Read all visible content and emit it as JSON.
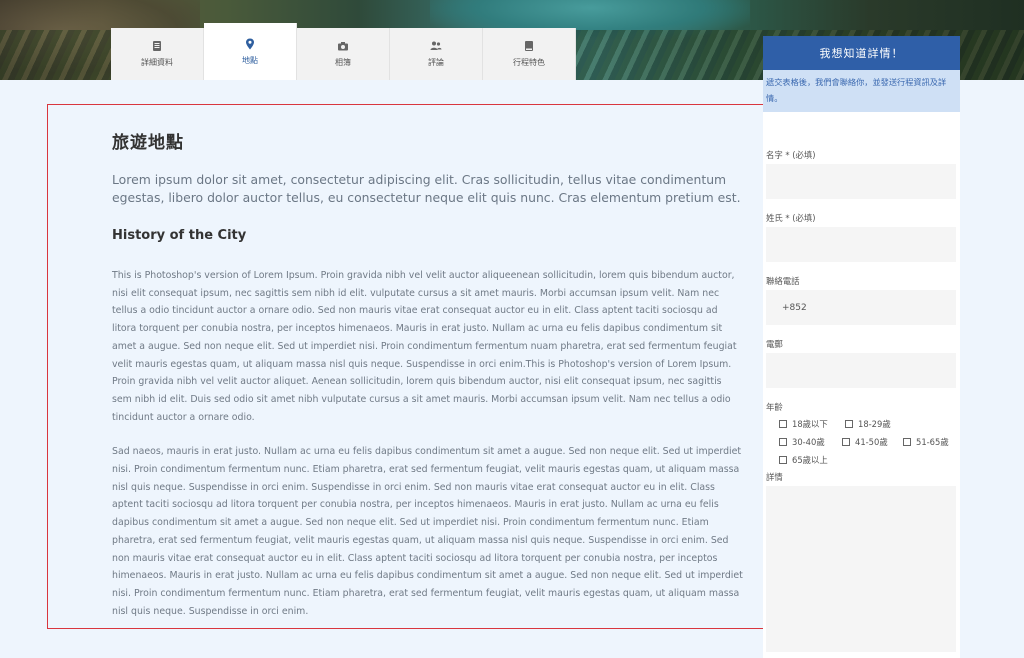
{
  "tabs": [
    {
      "label": "詳細資料",
      "icon": "document-icon"
    },
    {
      "label": "地點",
      "icon": "location-pin-icon"
    },
    {
      "label": "相簿",
      "icon": "camera-icon"
    },
    {
      "label": "評論",
      "icon": "users-icon"
    },
    {
      "label": "行程特色",
      "icon": "book-icon"
    }
  ],
  "active_tab": "地點",
  "content": {
    "title": "旅遊地點",
    "lead": "Lorem ipsum dolor sit amet, consectetur adipiscing elit. Cras sollicitudin, tellus vitae condimentum egestas, libero dolor auctor tellus, eu consectetur neque elit quis nunc. Cras elementum pretium est.",
    "subhead": "History of the City",
    "para1": "This is Photoshop's version  of Lorem Ipsum. Proin gravida nibh vel velit auctor aliqueenean sollicitudin, lorem quis bibendum auctor, nisi elit consequat ipsum, nec sagittis sem nibh id elit. vulputate cursus a sit amet mauris. Morbi accumsan ipsum velit. Nam nec tellus a odio tincidunt auctor a ornare odio. Sed non  mauris vitae erat consequat auctor eu in elit. Class aptent taciti sociosqu ad litora torquent per conubia nostra, per inceptos himenaeos. Mauris in erat justo. Nullam ac urna eu felis dapibus condimentum sit amet a augue. Sed non neque elit. Sed ut imperdiet nisi. Proin condimentum fermentum nuam pharetra, erat sed fermentum feugiat velit mauris egestas quam, ut aliquam massa nisl quis neque. Suspendisse in orci enim.This is Photoshop's version  of Lorem Ipsum. Proin gravida nibh vel velit auctor aliquet. Aenean sollicitudin, lorem quis bibendum auctor, nisi elit consequat ipsum, nec sagittis sem nibh id elit. Duis sed odio sit amet nibh vulputate cursus a sit amet mauris. Morbi accumsan ipsum velit. Nam nec tellus a odio tincidunt auctor a ornare odio.",
    "para2": "Sad naeos, mauris in erat justo. Nullam ac urna eu felis dapibus condimentum sit amet a augue. Sed non neque elit. Sed ut imperdiet nisi. Proin condimentum fermentum nunc. Etiam pharetra, erat sed fermentum feugiat, velit mauris egestas quam, ut aliquam massa nisl quis neque. Suspendisse in orci enim.  Suspendisse in orci enim. Sed non  mauris vitae erat consequat auctor eu in elit. Class aptent taciti sociosqu ad litora torquent per conubia nostra, per inceptos himenaeos. Mauris in erat justo. Nullam ac urna eu felis dapibus condimentum sit amet a augue. Sed non neque elit. Sed ut imperdiet nisi. Proin condimentum fermentum nunc. Etiam pharetra, erat sed fermentum feugiat, velit mauris egestas quam, ut aliquam massa nisl quis neque. Suspendisse in orci enim. Sed non  mauris vitae erat consequat auctor eu in elit. Class aptent taciti sociosqu ad litora torquent per conubia nostra, per inceptos himenaeos. Mauris in erat justo. Nullam ac urna eu felis dapibus condimentum sit amet a augue. Sed non neque elit. Sed ut imperdiet nisi. Proin condimentum fermentum nunc. Etiam pharetra, erat sed fermentum feugiat, velit mauris egestas quam, ut aliquam massa nisl quis neque. Suspendisse in orci enim."
  },
  "form": {
    "header": "我想知道詳情！",
    "note": "遞交表格後，我們會聯絡你，並發送行程資訊及詳情。",
    "first_name_label": "名字 * (必填)",
    "last_name_label": "姓氏 * (必填)",
    "phone_label": "聯絡電話",
    "phone_value": "+852",
    "email_label": "電郵",
    "age_label": "年齡",
    "age_options": [
      "18歲以下",
      "18-29歲",
      "30-40歲",
      "41-50歲",
      "51-65歲",
      "65歲以上"
    ],
    "details_label": "詳情"
  },
  "colors": {
    "accent": "#2f5fa8",
    "highlight_box": "#d9363e",
    "form_note_bg": "#cfe0f5",
    "page_bg": "#eef5fd"
  }
}
